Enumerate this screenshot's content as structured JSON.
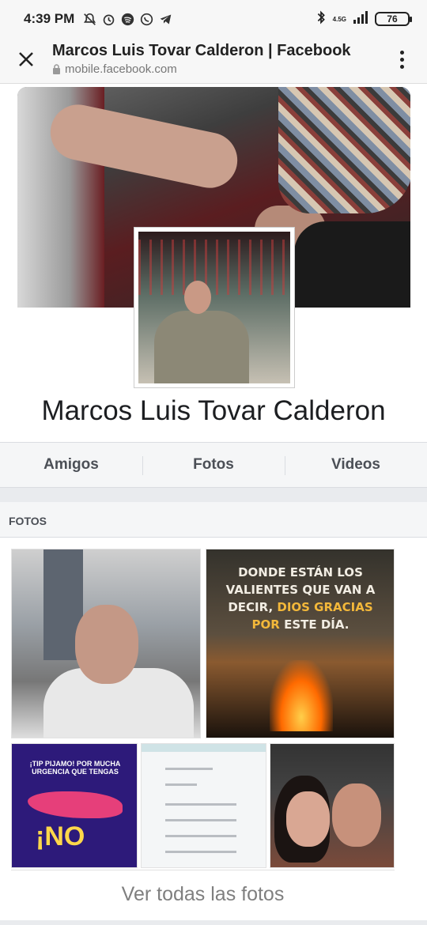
{
  "status_bar": {
    "time": "4:39 PM",
    "icons": [
      "notifications-off-icon",
      "alarm-icon",
      "spotify-icon",
      "whatsapp-icon",
      "telegram-icon"
    ],
    "network_top": "4.5G",
    "network_bottom": "⁴ᴳ",
    "battery": "76"
  },
  "browser": {
    "title": "Marcos Luis Tovar Calderon | Facebook",
    "url": "mobile.facebook.com"
  },
  "profile": {
    "name": "Marcos Luis Tovar Calderon"
  },
  "tabs": [
    {
      "label": "Amigos"
    },
    {
      "label": "Fotos"
    },
    {
      "label": "Videos"
    }
  ],
  "photos_section": {
    "header": "FOTOS",
    "quote_part1": "DONDE ESTÁN LOS VALIENTES QUE VAN A DECIR, ",
    "quote_highlight": "DIOS GRACIAS POR",
    "quote_part2": " ESTE DÍA.",
    "tip_text": "¡TIP PIJAMO! POR MUCHA URGENCIA QUE TENGAS",
    "no_text": "¡NO",
    "see_all": "Ver todas las fotos"
  },
  "colors": {
    "tabs_bg": "#f5f6f7",
    "divider": "#e9ebee",
    "quote_highlight": "#f3b83a"
  }
}
